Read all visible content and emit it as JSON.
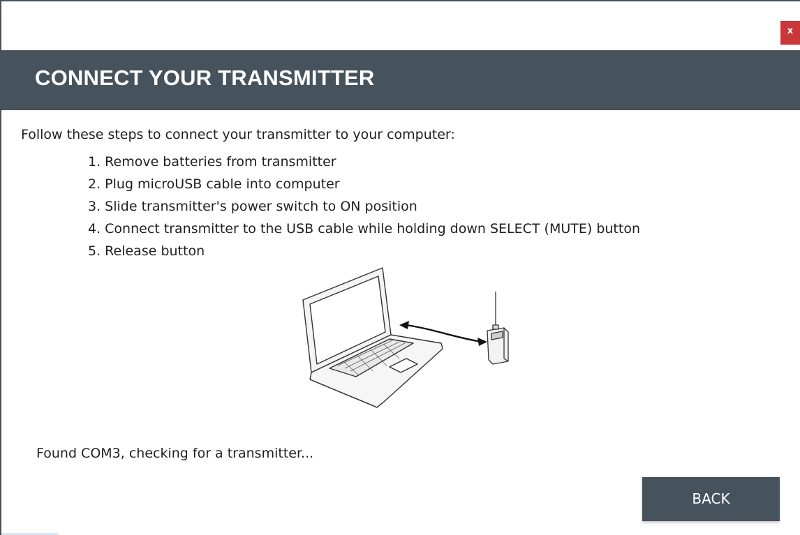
{
  "window": {
    "close_label": "x",
    "title": "CONNECT YOUR TRANSMITTER"
  },
  "content": {
    "intro": "Follow these steps to connect your transmitter to your computer:",
    "steps": [
      "1. Remove batteries from transmitter",
      "2. Plug microUSB cable into computer",
      "3. Slide transmitter's power switch to ON position",
      "4. Connect transmitter to the USB cable while holding down SELECT (MUTE) button",
      "5. Release button"
    ],
    "illustration_icon": "laptop-transmitter-usb-illustration",
    "status": "Found COM3, checking for a transmitter..."
  },
  "footer": {
    "back_label": "BACK"
  },
  "colors": {
    "header": "#46535d",
    "close": "#c9373a",
    "button": "#46535d",
    "text": "#1f1f1f"
  }
}
